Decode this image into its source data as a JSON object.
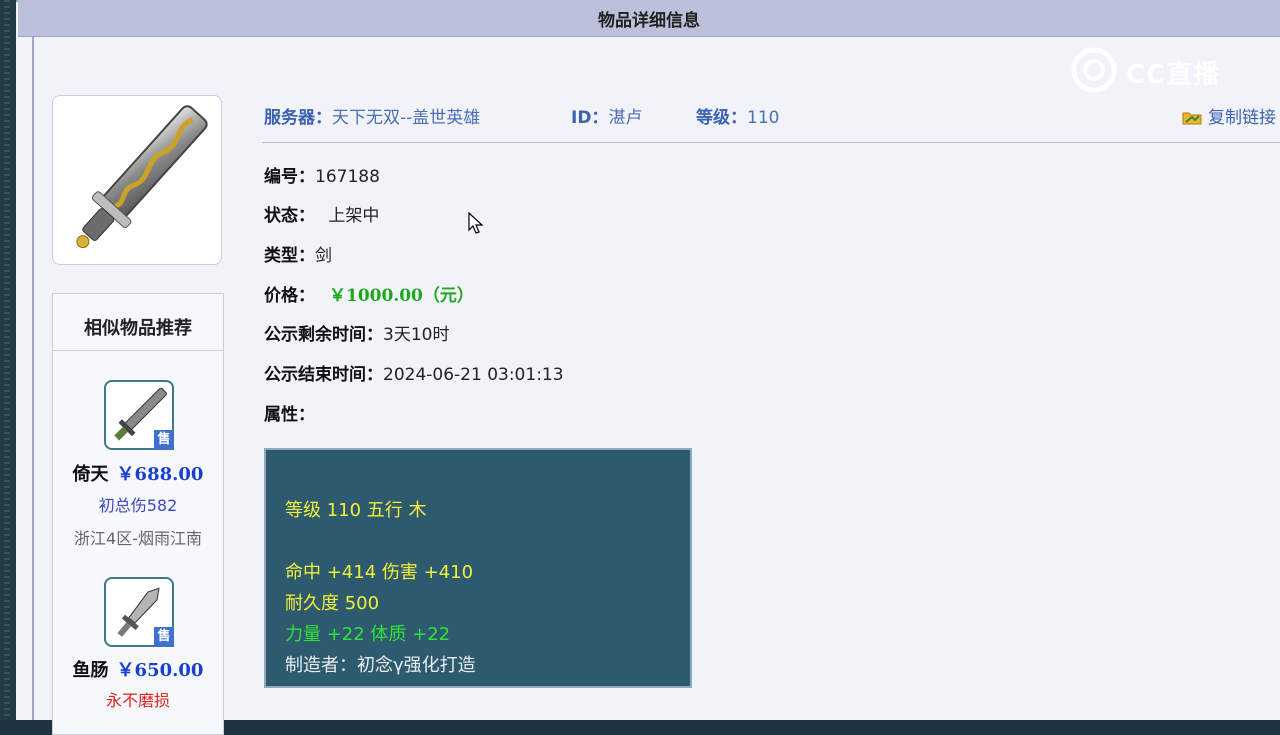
{
  "header": {
    "title": "物品详细信息"
  },
  "item": {
    "server_label": "服务器：",
    "server_value": "天下无双--盖世英雄",
    "id_label": "ID：",
    "id_value": "湛卢",
    "level_label": "等级：",
    "level_value": "110",
    "copy_link": "复制链接"
  },
  "fields": {
    "number_label": "编号：",
    "number_value": "167188",
    "status_label": "状态：",
    "status_value": "上架中",
    "type_label": "类型：",
    "type_value": "剑",
    "price_label": "价格：",
    "price_value": "￥1000.00（元）",
    "remaining_label": "公示剩余时间：",
    "remaining_value": "3天10时",
    "end_label": "公示结束时间：",
    "end_value": "2024-06-21 03:01:13",
    "attr_label": "属性："
  },
  "attributes": {
    "line1": "等级 110 五行 木",
    "line2": "命中 +414 伤害 +410",
    "line3": "耐久度 500",
    "line4": "力量 +22 体质 +22",
    "line5": "制造者：初念γ强化打造"
  },
  "recommend": {
    "title": "相似物品推荐",
    "sale_badge": "售",
    "items": [
      {
        "name": "倚天",
        "price": "￥688.00",
        "desc": "初总伤582",
        "server": "浙江4区-烟雨江南"
      },
      {
        "name": "鱼肠",
        "price": "￥650.00",
        "desc": "永不磨损"
      }
    ]
  },
  "watermark": {
    "text": "CC直播"
  },
  "colors": {
    "price_green": "#1fa81f",
    "attr_bg": "#2d5a6e",
    "attr_yellow": "#f2ef3a",
    "attr_green": "#32e23c",
    "link_blue": "#3c62b0"
  }
}
